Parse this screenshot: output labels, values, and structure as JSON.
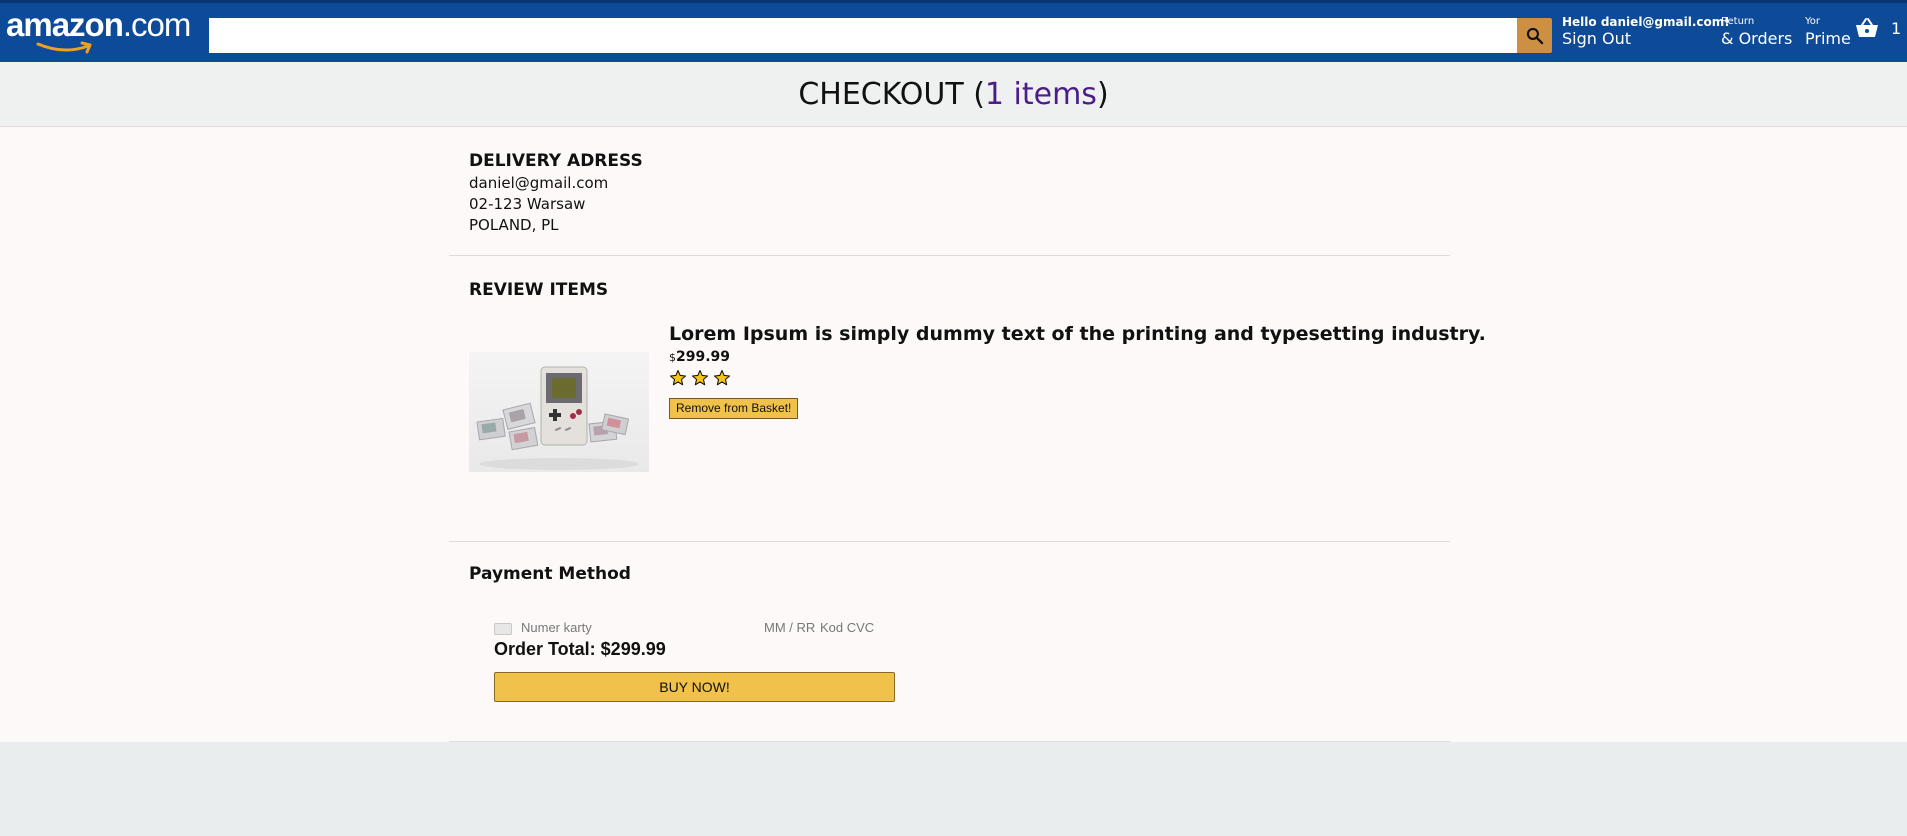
{
  "header": {
    "logo": {
      "main": "amazon",
      "suffix": ".com"
    },
    "search": {
      "value": "",
      "placeholder": ""
    },
    "user": {
      "greeting": "Hello daniel@gmail.com!",
      "action": "Sign Out"
    },
    "orders": {
      "line1": "Return",
      "line2": "& Orders"
    },
    "prime": {
      "line1": "Yor",
      "line2": "Prime"
    },
    "basket": {
      "count": "1"
    },
    "colors": {
      "bar": "#0d4a97",
      "search_button": "#cd9042"
    }
  },
  "checkout": {
    "title": "CHECKOUT (",
    "items_link": "1 items",
    "title_end": ")"
  },
  "delivery": {
    "heading": "DELIVERY ADRESS",
    "lines": [
      "daniel@gmail.com",
      "02-123 Warsaw",
      "POLAND, PL"
    ]
  },
  "review": {
    "heading": "REVIEW ITEMS",
    "item": {
      "title": "Lorem Ipsum is simply dummy text of the printing and typesetting industry.",
      "currency": "$",
      "price": "299.99",
      "rating": 3,
      "remove_label": "Remove from Basket!",
      "image_icon": "game-console-image"
    }
  },
  "payment": {
    "heading": "Payment Method",
    "card_number_placeholder": "Numer karty",
    "expiry_placeholder": "MM / RR",
    "cvc_placeholder": "Kod CVC",
    "order_total": "Order Total: $299.99",
    "buy_label": "BUY NOW!",
    "button_color": "#f0c14b"
  }
}
